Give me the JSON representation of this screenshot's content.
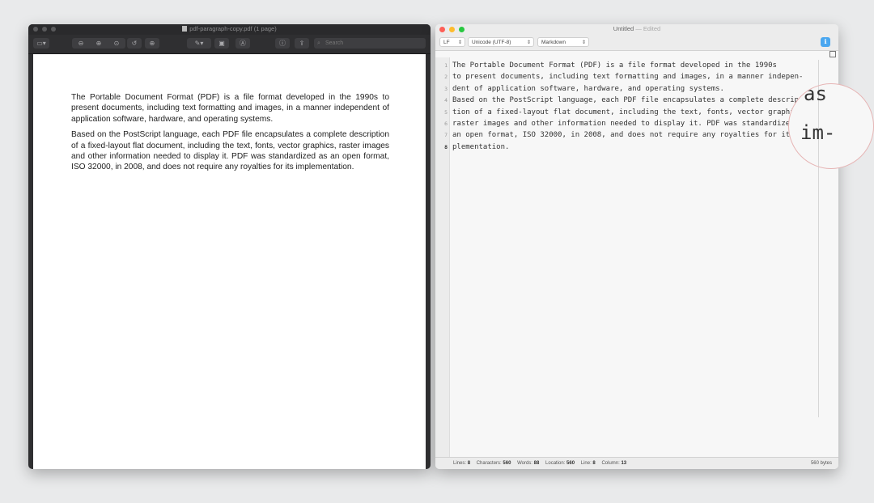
{
  "preview": {
    "title": "pdf-paragraph-copy.pdf (1 page)",
    "search_placeholder": "Search",
    "paragraphs": [
      "The Portable Document Format (PDF) is a file format developed in the 1990s to present documents, including text formatting and images, in a manner independent of application software, hardware, and operating systems.",
      "Based on the PostScript language, each PDF file encapsulates a complete description of a fixed-layout flat document, including the text, fonts, vector graphics, raster images and other information needed to display it. PDF was standardized as an open format, ISO 32000, in 2008, and does not require any royalties for its implementation."
    ],
    "toolbar_icons": [
      "sidebar-icon",
      "zoom-out-icon",
      "zoom-in-icon",
      "zoom-fit-icon",
      "rotate-icon",
      "pen-icon",
      "markup-icon",
      "annotate-icon",
      "info-icon",
      "share-icon",
      "search-icon"
    ]
  },
  "editor": {
    "title": "Untitled",
    "title_suffix": "— Edited",
    "line_ending": "LF",
    "encoding": "Unicode (UTF-8)",
    "syntax": "Markdown",
    "line_numbers": [
      "1",
      "2",
      "3",
      "4",
      "5",
      "6",
      "7",
      "8"
    ],
    "lines": [
      "The Portable Document Format (PDF) is a file format developed in the 1990s",
      "to present documents, including text formatting and images, in a manner indepen-",
      "dent of application software, hardware, and operating systems.",
      "Based on the PostScript language, each PDF file encapsulates a complete descrip-",
      "tion of a fixed-layout flat document, including the text, fonts, vector graphics,",
      "raster images and other information needed to display it. PDF was standardized as",
      "an open format, ISO 32000, in 2008, and does not require any royalties for its im-",
      "plementation."
    ],
    "status": {
      "lines_label": "Lines:",
      "lines": "8",
      "chars_label": "Characters:",
      "chars": "560",
      "words_label": "Words:",
      "words": "88",
      "location_label": "Location:",
      "location": "560",
      "line_label": "Line:",
      "line": "8",
      "column_label": "Column:",
      "column": "13",
      "bytes": "560 bytes"
    }
  },
  "magnifier": {
    "line1": "as",
    "line2": "im-"
  },
  "colors": {
    "close": "#fe5f57",
    "minimize": "#febc2e",
    "zoom": "#28c840",
    "accent": "#4aa7f0"
  }
}
